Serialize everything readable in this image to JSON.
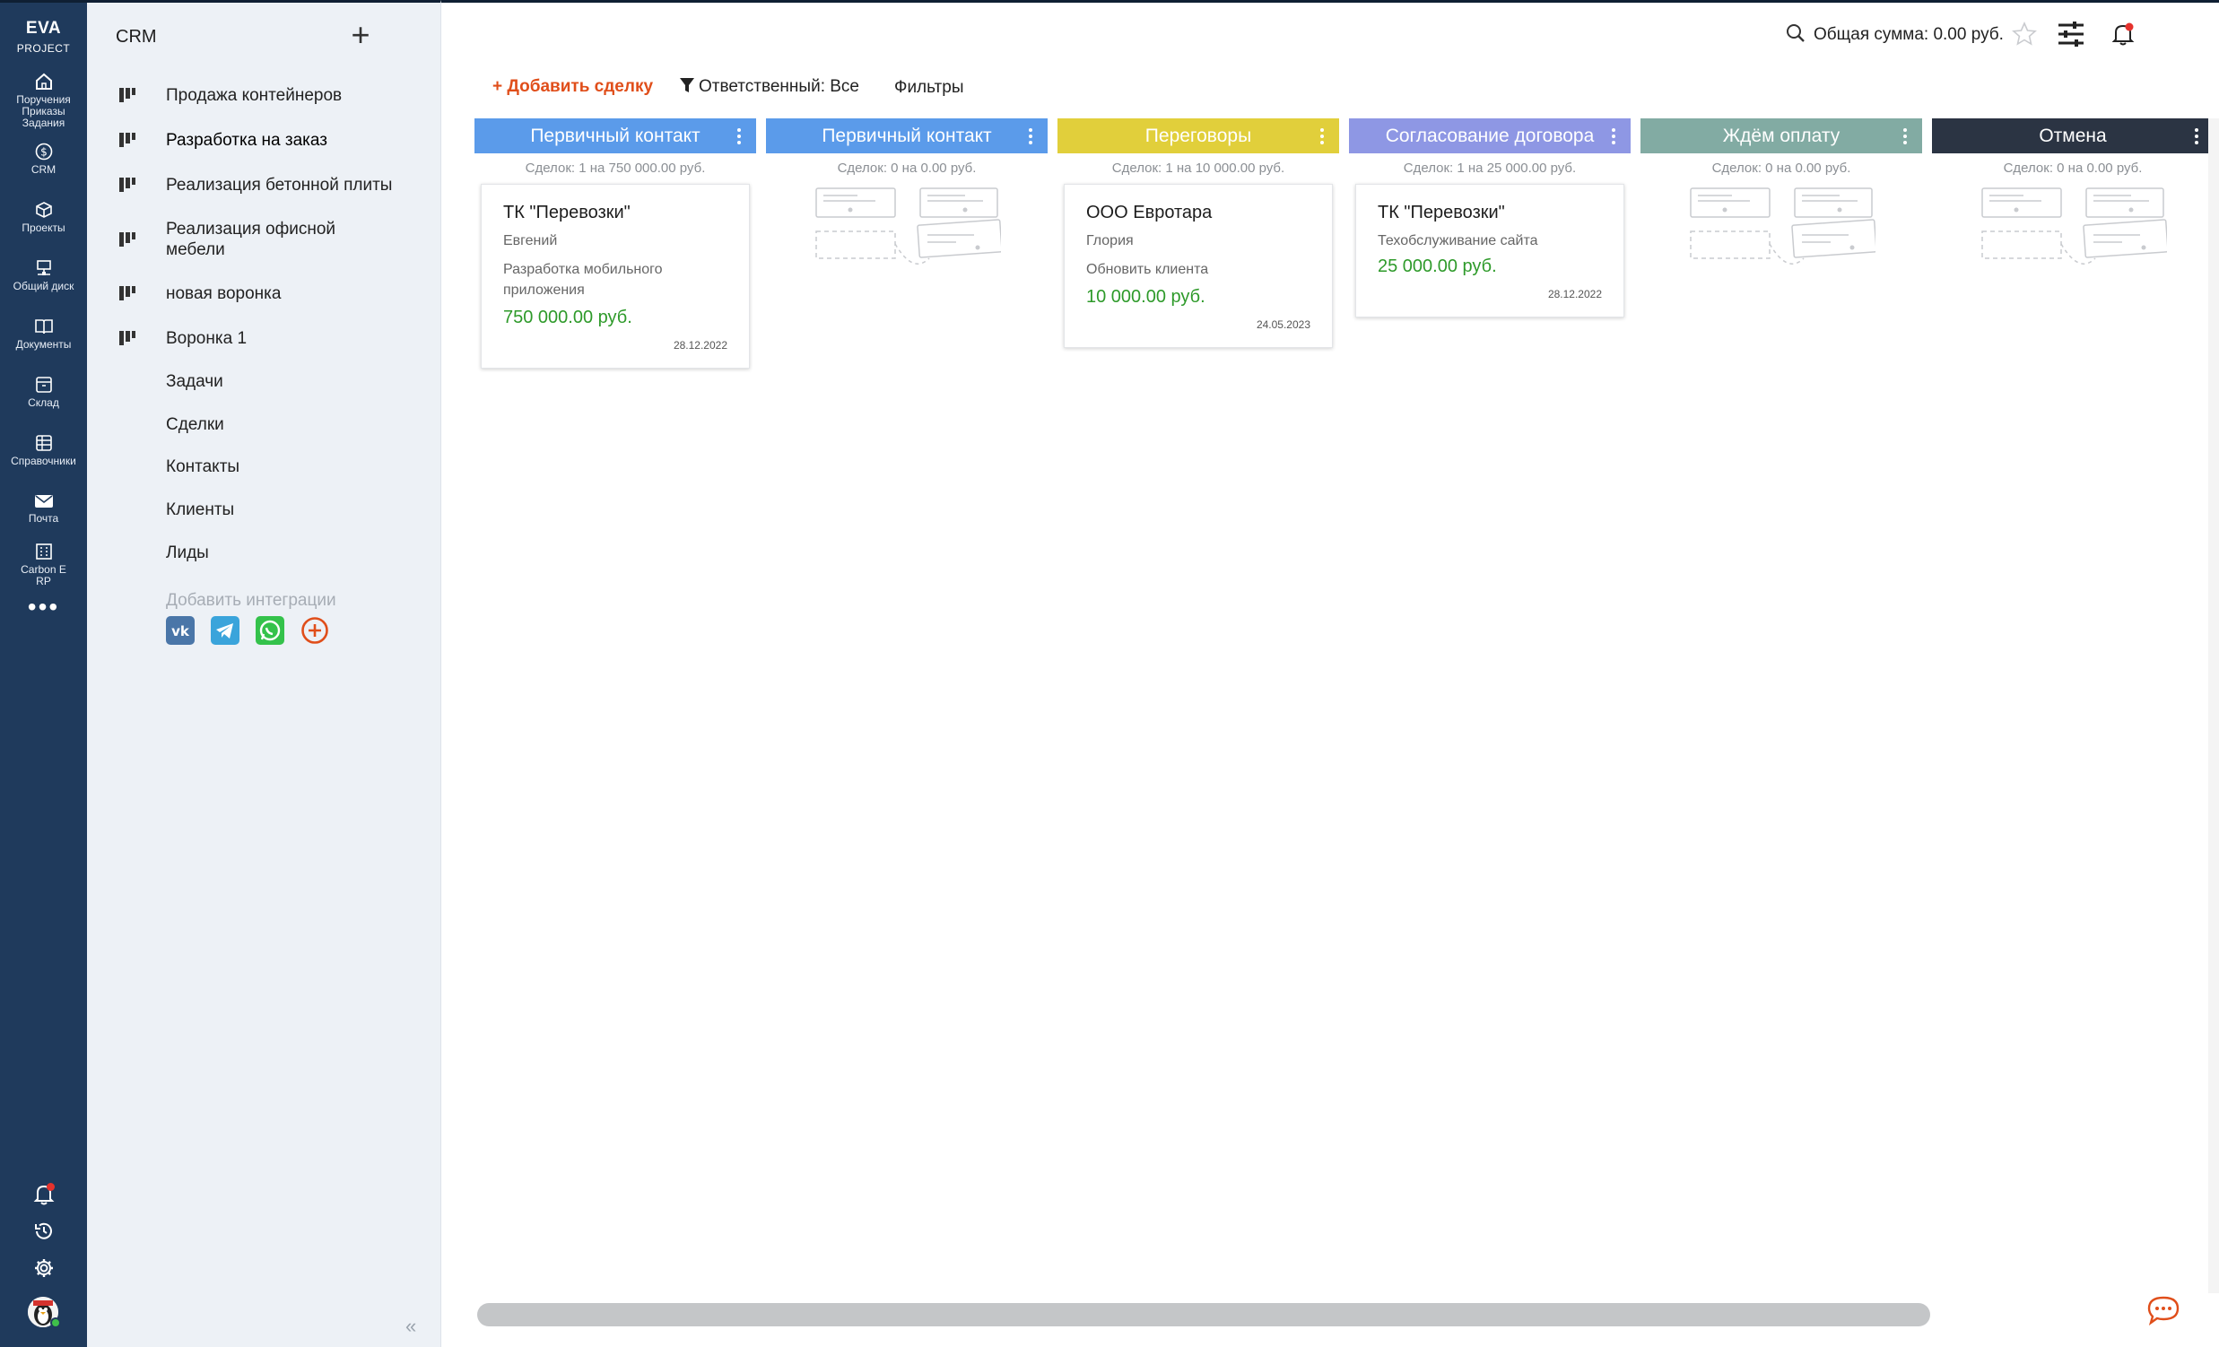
{
  "app": {
    "logo_line1": "EVA",
    "logo_line2": "PROJECT"
  },
  "rail": {
    "items": [
      {
        "label": "Поручения Приказы Задания",
        "icon": "home-icon"
      },
      {
        "label": "CRM",
        "icon": "crm-icon"
      },
      {
        "label": "Проекты",
        "icon": "cube-icon"
      },
      {
        "label": "Общий диск",
        "icon": "network-drive-icon"
      },
      {
        "label": "Документы",
        "icon": "book-icon"
      },
      {
        "label": "Склад",
        "icon": "box-icon"
      },
      {
        "label": "Справочники",
        "icon": "table-icon"
      },
      {
        "label": "Почта",
        "icon": "mail-icon"
      },
      {
        "label": "Carbon E RP",
        "icon": "building-icon"
      }
    ],
    "more": "•••"
  },
  "sidebar": {
    "title": "CRM",
    "add": "+",
    "funnels": [
      "Продажа контейнеров",
      "Разработка на заказ",
      "Реализация бетонной плиты",
      "Реализация офисной мебели",
      "новая воронка",
      "Воронка 1"
    ],
    "links": [
      "Задачи",
      "Сделки",
      "Контакты",
      "Клиенты",
      "Лиды"
    ],
    "integrations_title": "Добавить интеграции",
    "collapse": "«"
  },
  "topbar": {
    "sum": "Общая сумма: 0.00 руб."
  },
  "toolbar": {
    "add_deal": "+ Добавить сделку",
    "responsible": "Ответственный: Все",
    "filters": "Фильтры"
  },
  "colors": {
    "blue": "#5b9bea",
    "yellow": "#e1cf3b",
    "violet": "#8e97e4",
    "teal": "#82aba3",
    "dark": "#2b3443",
    "accent": "#e04e1a",
    "money": "#2e9a2a"
  },
  "columns": [
    {
      "title": "Первичный контакт",
      "stats": "Сделок: 1 на 750 000.00  руб.",
      "color": "#5b9bea",
      "card": {
        "title": "ТК \"Перевозки\"",
        "contact": "Евгений",
        "desc": "Разработка мобильного приложения",
        "amount": "750 000.00  руб.",
        "date": "28.12.2022"
      }
    },
    {
      "title": "Первичный контакт",
      "stats": "Сделок: 0 на 0.00 руб.",
      "color": "#5b9bea"
    },
    {
      "title": "Переговоры",
      "stats": "Сделок: 1 на 10 000.00  руб.",
      "color": "#e1cf3b",
      "card": {
        "title": "ООО Евротара",
        "contact": "Глория",
        "desc": "Обновить клиента",
        "amount": "10 000.00  руб.",
        "date": "24.05.2023"
      }
    },
    {
      "title": "Согласование договора",
      "stats": "Сделок: 1 на 25 000.00  руб.",
      "color": "#8e97e4",
      "card": {
        "title": "ТК \"Перевозки\"",
        "contact": "Техобслуживание сайта",
        "amount": "25 000.00  руб.",
        "date": "28.12.2022"
      }
    },
    {
      "title": "Ждём оплату",
      "stats": "Сделок: 0 на 0.00 руб.",
      "color": "#82aba3"
    },
    {
      "title": "Отмена",
      "stats": "Сделок: 0 на 0.00 руб.",
      "color": "#2b3443"
    }
  ]
}
